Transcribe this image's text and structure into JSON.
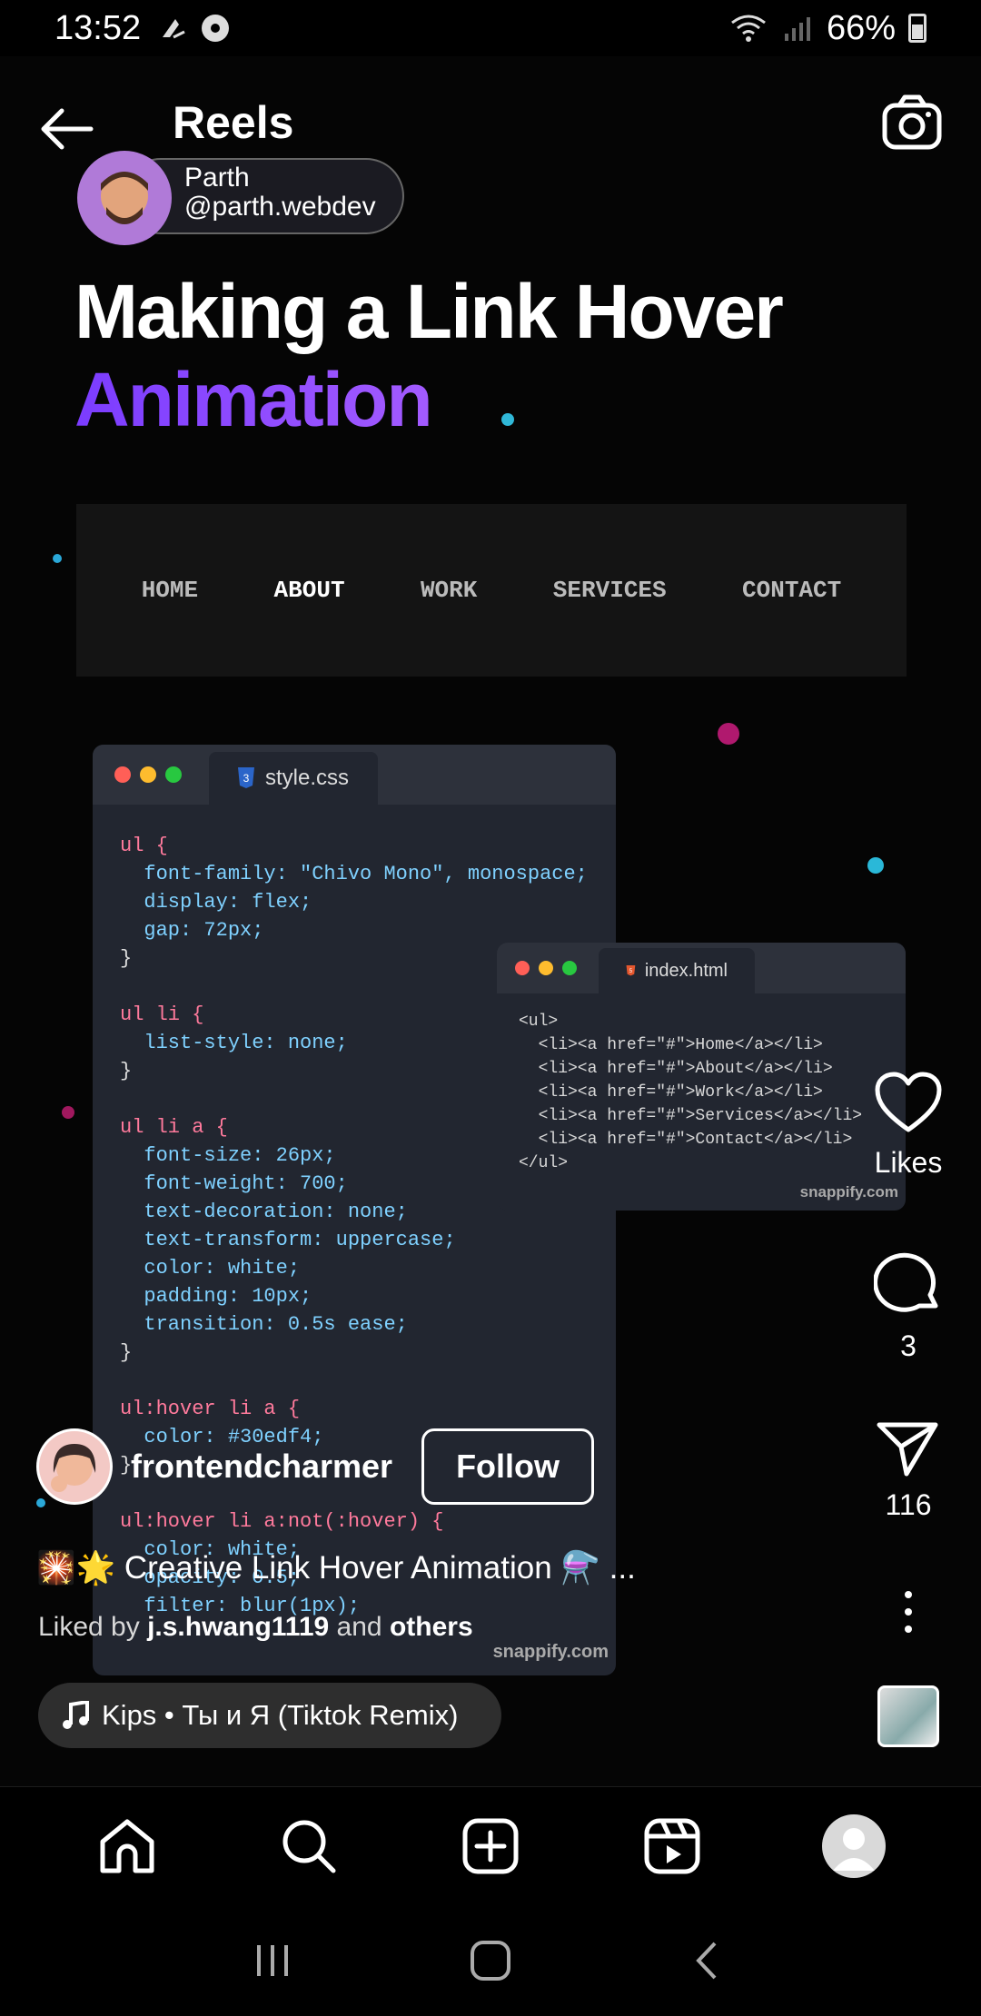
{
  "status_bar": {
    "time": "13:52",
    "battery": "66%"
  },
  "header": {
    "title": "Reels"
  },
  "video": {
    "creator_name": "Parth",
    "creator_handle": "@parth.webdev",
    "headline_line1": "Making a Link Hover",
    "headline_line2": "Animation",
    "nav_demo": [
      "HOME",
      "ABOUT",
      "WORK",
      "SERVICES",
      "CONTACT"
    ],
    "css_tab": "style.css",
    "html_tab": "index.html",
    "watermark": "snappify.com",
    "css_lines": [
      "ul {",
      "  font-family: \"Chivo Mono\", monospace;",
      "  display: flex;",
      "  gap: 72px;",
      "}",
      "",
      "ul li {",
      "  list-style: none;",
      "}",
      "",
      "ul li a {",
      "  font-size: 26px;",
      "  font-weight: 700;",
      "  text-decoration: none;",
      "  text-transform: uppercase;",
      "  color: white;",
      "  padding: 10px;",
      "  transition: 0.5s ease;",
      "}",
      "",
      "ul:hover li a {",
      "  color: #30edf4;",
      "}",
      "",
      "ul:hover li a:not(:hover) {",
      "  color: white;",
      "  opacity: 0.5;",
      "  filter: blur(1px);"
    ],
    "html_lines": [
      "<ul>",
      "  <li><a href=\"#\">Home</a></li>",
      "  <li><a href=\"#\">About</a></li>",
      "  <li><a href=\"#\">Work</a></li>",
      "  <li><a href=\"#\">Services</a></li>",
      "  <li><a href=\"#\">Contact</a></li>",
      "</ul>"
    ]
  },
  "actions": {
    "likes_label": "Likes",
    "comments_count": "3",
    "shares_count": "116"
  },
  "post": {
    "username": "frontendcharmer",
    "follow_label": "Follow",
    "caption": "🎇🌟 Creative Link Hover Animation ⚗️ ...",
    "liked_prefix": "Liked by ",
    "liked_user": "j.s.hwang1119",
    "liked_mid": " and ",
    "liked_others": "others",
    "audio": "Kips • Ты и Я (Tiktok Remix)"
  },
  "colors": {
    "accent_purple": "#7b3cff",
    "background": "#000000"
  }
}
